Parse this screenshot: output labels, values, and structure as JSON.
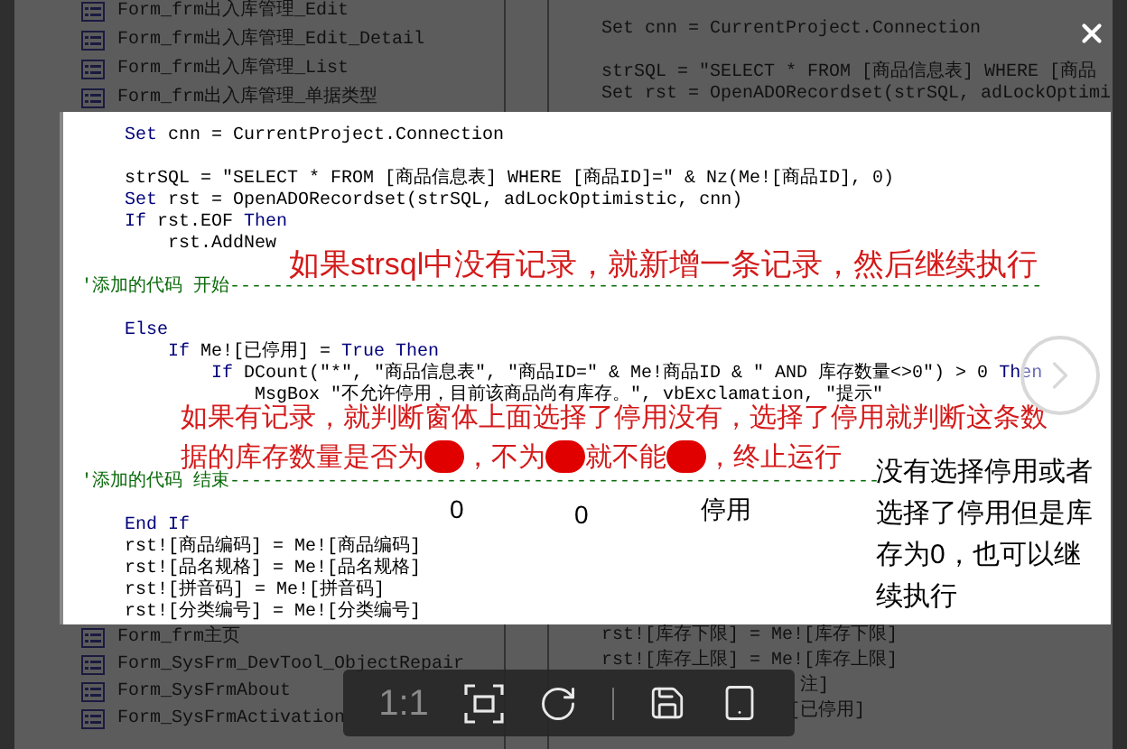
{
  "background": {
    "tree_top": [
      "Form_frm出入库管理_Edit",
      "Form_frm出入库管理_Edit_Detail",
      "Form_frm出入库管理_List",
      "Form_frm出入库管理_单据类型"
    ],
    "tree_bottom": [
      "Form_frm主页",
      "Form_SysFrm_DevTool_ObjectRepair",
      "Form_SysFrmAbout",
      "Form_SysFrmActivation"
    ],
    "code_top": [
      "Set cnn = CurrentProject.Connection",
      "strSQL = \"SELECT * FROM [商品信息表] WHERE [商品",
      "Set rst = OpenADORecordset(strSQL, adLockOptimi"
    ],
    "code_bottom": [
      "rst![库存下限] = Me![库存下限]",
      "rst![库存上限] = Me![库存上限]"
    ],
    "code_tails": [
      "注]",
      "[已停用]"
    ]
  },
  "image": {
    "code_lines": [
      {
        "kind": "code",
        "parts": [
          {
            "kind": "keyword",
            "text": "    Set"
          },
          {
            "kind": "plain",
            "text": " cnn = CurrentProject.Connection"
          }
        ]
      },
      {
        "kind": "blank"
      },
      {
        "kind": "code",
        "parts": [
          {
            "kind": "plain",
            "text": "    strSQL = \"SELECT * FROM [商品信息表] WHERE [商品ID]=\" & Nz(Me![商品ID], 0)"
          }
        ]
      },
      {
        "kind": "code",
        "parts": [
          {
            "kind": "keyword",
            "text": "    Set"
          },
          {
            "kind": "plain",
            "text": " rst = OpenADORecordset(strSQL, adLockOptimistic, cnn)"
          }
        ]
      },
      {
        "kind": "code",
        "parts": [
          {
            "kind": "keyword",
            "text": "    If"
          },
          {
            "kind": "plain",
            "text": " rst.EOF "
          },
          {
            "kind": "keyword",
            "text": "Then"
          }
        ]
      },
      {
        "kind": "code",
        "parts": [
          {
            "kind": "plain",
            "text": "        rst.AddNew"
          }
        ]
      },
      {
        "kind": "blank"
      },
      {
        "kind": "comment",
        "text": "'添加的代码 开始---------------------------------------------------------------------------"
      },
      {
        "kind": "blank"
      },
      {
        "kind": "code",
        "parts": [
          {
            "kind": "keyword",
            "text": "    Else"
          }
        ]
      },
      {
        "kind": "code",
        "parts": [
          {
            "kind": "keyword",
            "text": "        If"
          },
          {
            "kind": "plain",
            "text": " Me![已停用] = "
          },
          {
            "kind": "keyword",
            "text": "True Then"
          }
        ]
      },
      {
        "kind": "code",
        "parts": [
          {
            "kind": "keyword",
            "text": "            If"
          },
          {
            "kind": "plain",
            "text": " DCount(\"*\", \"商品信息表\", \"商品ID=\" & Me!商品ID & \" AND 库存数量<>0\") > 0 "
          },
          {
            "kind": "keyword",
            "text": "Then"
          }
        ]
      },
      {
        "kind": "code",
        "parts": [
          {
            "kind": "plain",
            "text": "                MsgBox \"不允许停用，目前该商品尚有库存。\", vbExclamation, \"提示\""
          }
        ]
      },
      {
        "kind": "blank"
      },
      {
        "kind": "blank"
      },
      {
        "kind": "blank"
      },
      {
        "kind": "comment",
        "text": "'添加的代码 结束------------------------------------------------------------"
      },
      {
        "kind": "blank"
      },
      {
        "kind": "code",
        "parts": [
          {
            "kind": "keyword",
            "text": "    End If"
          }
        ]
      },
      {
        "kind": "code",
        "parts": [
          {
            "kind": "plain",
            "text": "    rst![商品编码] = Me![商品编码]"
          }
        ]
      },
      {
        "kind": "code",
        "parts": [
          {
            "kind": "plain",
            "text": "    rst![品名规格] = Me![品名规格]"
          }
        ]
      },
      {
        "kind": "code",
        "parts": [
          {
            "kind": "plain",
            "text": "    rst![拼音码] = Me![拼音码]"
          }
        ]
      },
      {
        "kind": "code",
        "parts": [
          {
            "kind": "plain",
            "text": "    rst![分类编号] = Me![分类编号]"
          }
        ]
      }
    ],
    "note_top": "如果strsql中没有记录，就新增一条记录，然后继续执行",
    "note_middle": "如果有记录，就判断窗体上面选择了停用没有，选择了停用就判断这条数",
    "note_pieces": [
      "据的库存数量是否为",
      "，不为",
      "就不能",
      "，终止运行"
    ],
    "handwritten": [
      "0",
      "0",
      "停用"
    ],
    "side_note": "没有选择停用或者选择了停用但是库存为0，也可以继续执行"
  },
  "toolbar": {
    "zoom_label": "1:1"
  }
}
